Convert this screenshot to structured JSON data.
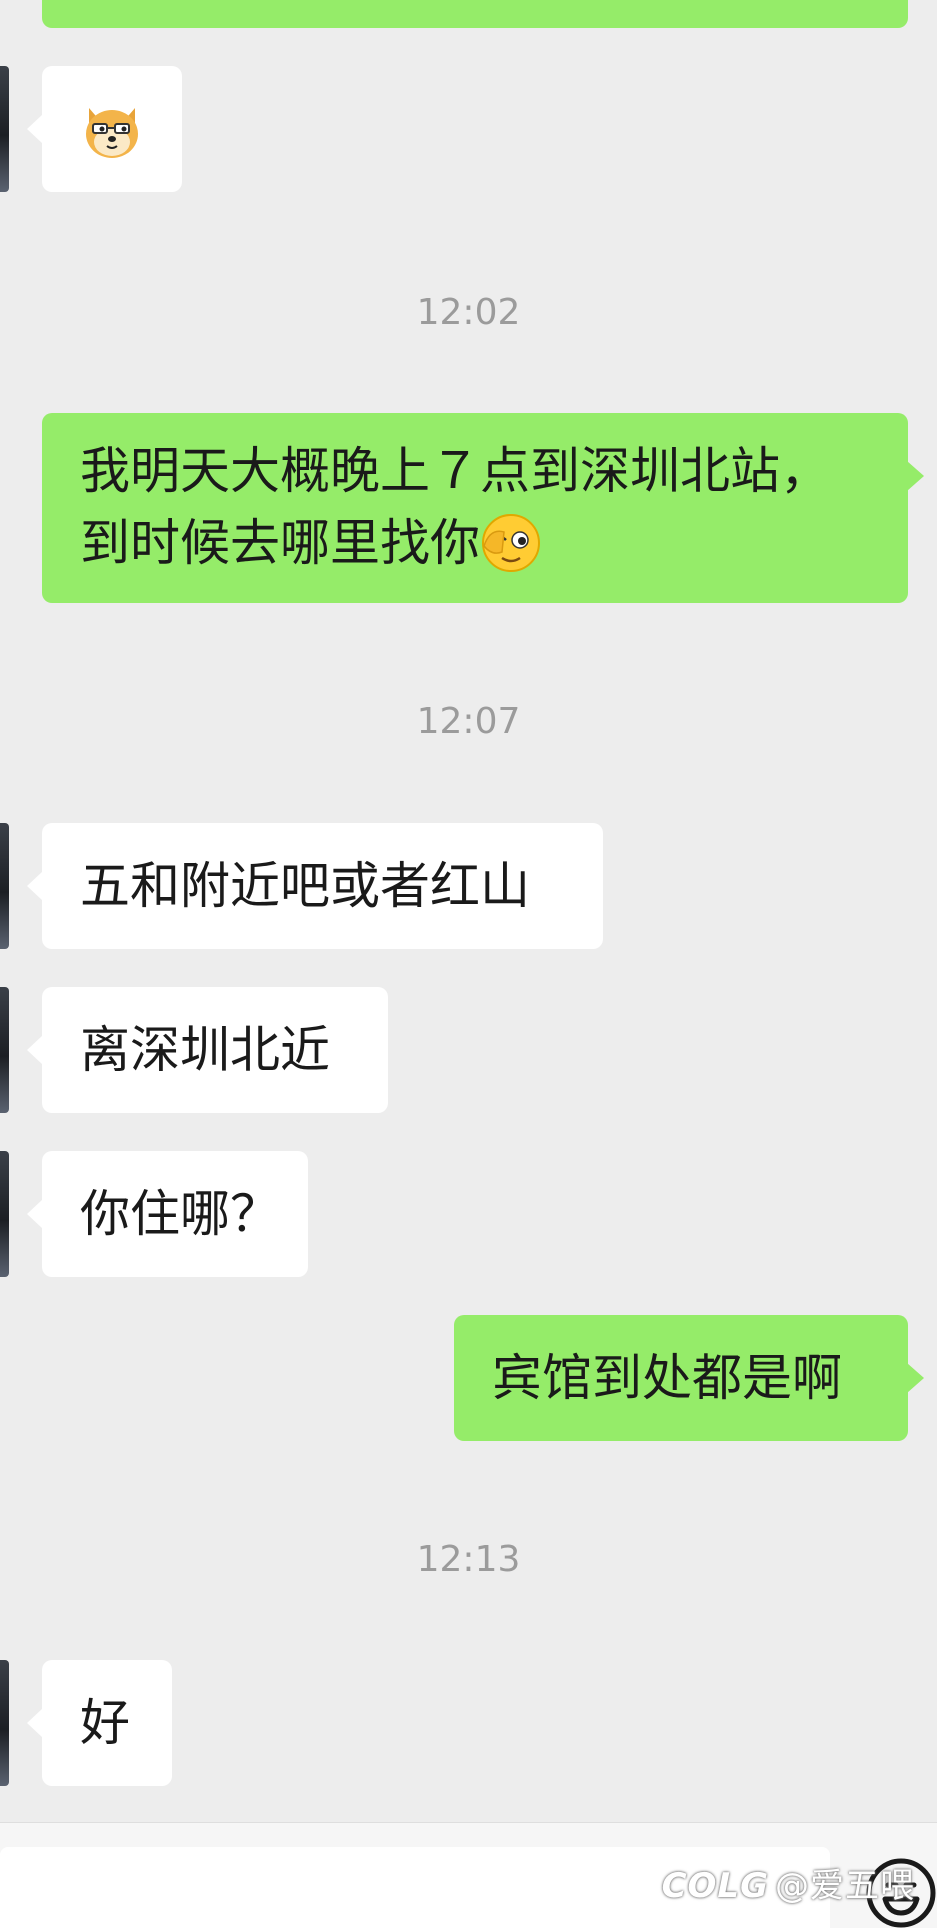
{
  "conversation": {
    "top_partial_message": {
      "sender": "me"
    },
    "sticker_message": {
      "sender": "other",
      "sticker": "doge-face-sticker"
    },
    "time_1": "12:02",
    "message_1": {
      "sender": "me",
      "line_1": "我明天大概晚上７点到深圳北站，",
      "line_2": "到时候去哪里找你",
      "trailing_emoji": "wink-face-emoji"
    },
    "time_2": "12:07",
    "message_2": {
      "sender": "other",
      "text": "五和附近吧或者红山"
    },
    "message_3": {
      "sender": "other",
      "text": "离深圳北近"
    },
    "message_4": {
      "sender": "other",
      "text": "你住哪？"
    },
    "message_5": {
      "sender": "me",
      "text": "宾馆到处都是啊"
    },
    "time_3": "12:13",
    "message_6": {
      "sender": "other",
      "text": "好"
    }
  },
  "input_bar": {
    "value": "",
    "emoji_button_icon": "face-icon"
  },
  "watermark": {
    "logo": "COLG",
    "handle": "@爱五喂"
  },
  "colors": {
    "background": "#ededed",
    "outgoing_bubble": "#95ec69",
    "incoming_bubble": "#ffffff",
    "timestamp_text": "#9b9b9b"
  }
}
